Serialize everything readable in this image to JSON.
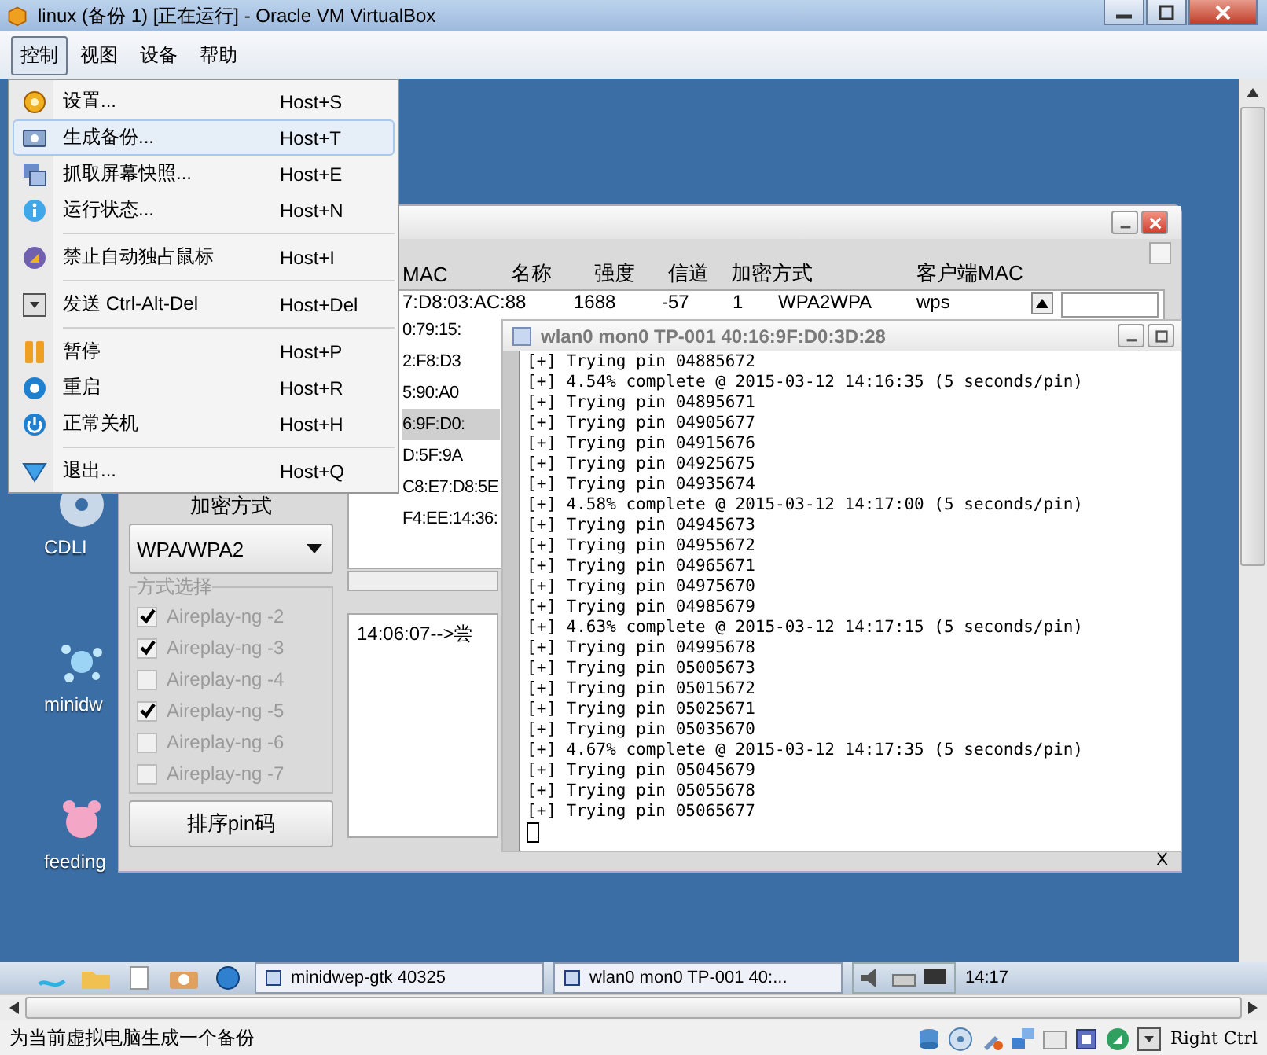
{
  "window": {
    "title": "linux (备份 1) [正在运行] - Oracle VM VirtualBox"
  },
  "menubar": [
    {
      "label": "控制",
      "selected": true
    },
    {
      "label": "视图",
      "selected": false
    },
    {
      "label": "设备",
      "selected": false
    },
    {
      "label": "帮助",
      "selected": false
    }
  ],
  "menu": {
    "groups": [
      [
        {
          "kind": "gear",
          "label": "设置...",
          "shortcut": "Host+S",
          "selected": false
        },
        {
          "kind": "camera",
          "label": "生成备份...",
          "shortcut": "Host+T",
          "selected": true
        },
        {
          "kind": "screenshot",
          "label": "抓取屏幕快照...",
          "shortcut": "Host+E",
          "selected": false
        },
        {
          "kind": "info",
          "label": "运行状态...",
          "shortcut": "Host+N",
          "selected": false
        }
      ],
      [
        {
          "kind": "mouse",
          "label": "禁止自动独占鼠标",
          "shortcut": "Host+I",
          "selected": false
        }
      ],
      [
        {
          "kind": "key",
          "label": "发送 Ctrl-Alt-Del",
          "shortcut": "Host+Del",
          "selected": false
        }
      ],
      [
        {
          "kind": "pause",
          "label": "暂停",
          "shortcut": "Host+P",
          "selected": false
        },
        {
          "kind": "restart",
          "label": "重启",
          "shortcut": "Host+R",
          "selected": false
        },
        {
          "kind": "power",
          "label": "正常关机",
          "shortcut": "Host+H",
          "selected": false
        }
      ],
      [
        {
          "kind": "exit",
          "label": "退出...",
          "shortcut": "Host+Q",
          "selected": false
        }
      ]
    ]
  },
  "desktop_icons": [
    {
      "kind": "disc",
      "label": "CDLI"
    },
    {
      "kind": "splash",
      "label": "minidw"
    },
    {
      "kind": "bear",
      "label": "feeding"
    }
  ],
  "scanner_window": {
    "columns": [
      "MAC",
      "名称",
      "强度",
      "信道",
      "加密方式",
      "客户端MAC"
    ],
    "first_row": [
      "7:D8:03:AC:88",
      "1688",
      "-57",
      "1",
      "WPA2WPA",
      "wps"
    ],
    "mac_rows": [
      {
        "text": "0:79:15:",
        "selected": false
      },
      {
        "text": "2:F8:D3",
        "selected": false
      },
      {
        "text": "5:90:A0",
        "selected": false
      },
      {
        "text": "6:9F:D0:",
        "selected": true
      },
      {
        "text": "D:5F:9A",
        "selected": false
      },
      {
        "text": "C8:E7:D8:5E",
        "selected": false
      },
      {
        "text": "F4:EE:14:36:",
        "selected": false
      }
    ],
    "encryption_label": "加密方式",
    "encryption_value": "WPA/WPA2",
    "method_group": {
      "title": "方式选择",
      "disabled": true,
      "options": [
        {
          "label": "Aireplay-ng -2",
          "checked": true
        },
        {
          "label": "Aireplay-ng -3",
          "checked": true
        },
        {
          "label": "Aireplay-ng -4",
          "checked": false
        },
        {
          "label": "Aireplay-ng -5",
          "checked": true
        },
        {
          "label": "Aireplay-ng -6",
          "checked": false
        },
        {
          "label": "Aireplay-ng -7",
          "checked": false
        }
      ]
    },
    "sort_button": "排序pin码",
    "log": "14:06:07-->尝",
    "footer_close": "X"
  },
  "terminal": {
    "title": "wlan0 mon0 TP-001 40:16:9F:D0:3D:28",
    "lines": [
      "[+] Trying pin 04885672",
      "[+] 4.54% complete @ 2015-03-12 14:16:35 (5 seconds/pin)",
      "[+] Trying pin 04895671",
      "[+] Trying pin 04905677",
      "[+] Trying pin 04915676",
      "[+] Trying pin 04925675",
      "[+] Trying pin 04935674",
      "[+] 4.58% complete @ 2015-03-12 14:17:00 (5 seconds/pin)",
      "[+] Trying pin 04945673",
      "[+] Trying pin 04955672",
      "[+] Trying pin 04965671",
      "[+] Trying pin 04975670",
      "[+] Trying pin 04985679",
      "[+] 4.63% complete @ 2015-03-12 14:17:15 (5 seconds/pin)",
      "[+] Trying pin 04995678",
      "[+] Trying pin 05005673",
      "[+] Trying pin 05015672",
      "[+] Trying pin 05025671",
      "[+] Trying pin 05035670",
      "[+] 4.67% complete @ 2015-03-12 14:17:35 (5 seconds/pin)",
      "[+] Trying pin 05045679",
      "[+] Trying pin 05055678",
      "[+] Trying pin 05065677"
    ]
  },
  "taskbar": {
    "tasks": [
      {
        "label": "minidwep-gtk 40325"
      },
      {
        "label": "wlan0 mon0 TP-001 40:..."
      }
    ],
    "clock": "14:17"
  },
  "status_bar": {
    "message": "为当前虚拟电脑生成一个备份",
    "host_key": "Right Ctrl"
  }
}
